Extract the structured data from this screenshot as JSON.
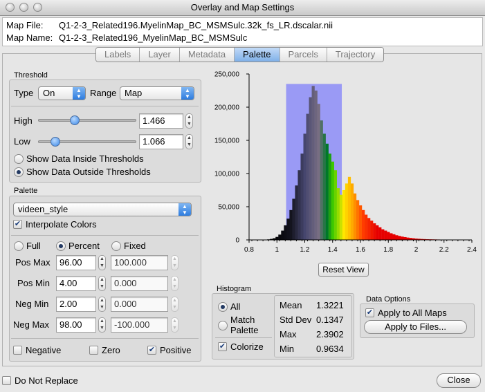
{
  "window": {
    "title": "Overlay and Map Settings"
  },
  "info": {
    "map_file_label": "Map File:",
    "map_file_value": "Q1-2-3_Related196.MyelinMap_BC_MSMSulc.32k_fs_LR.dscalar.nii",
    "map_name_label": "Map Name:",
    "map_name_value": "Q1-2-3_Related196_MyelinMap_BC_MSMSulc"
  },
  "tabs": [
    "Labels",
    "Layer",
    "Metadata",
    "Palette",
    "Parcels",
    "Trajectory"
  ],
  "active_tab": "Palette",
  "threshold": {
    "group_label": "Threshold",
    "type_label": "Type",
    "type_value": "On",
    "range_label": "Range",
    "range_value": "Map",
    "high_label": "High",
    "high_value": "1.466",
    "high_slider_fraction": 0.36,
    "low_label": "Low",
    "low_value": "1.066",
    "low_slider_fraction": 0.14,
    "inside_label": "Show Data Inside Thresholds",
    "outside_label": "Show Data Outside Thresholds",
    "selected": "outside"
  },
  "palette": {
    "group_label": "Palette",
    "name": "videen_style",
    "interpolate_label": "Interpolate Colors",
    "interpolate_checked": true,
    "mode_full": "Full",
    "mode_percent": "Percent",
    "mode_fixed": "Fixed",
    "mode_selected": "Percent",
    "pos_max_label": "Pos Max",
    "pos_max_value": "96.00",
    "pos_max_fixed": "100.000",
    "pos_min_label": "Pos Min",
    "pos_min_value": "4.00",
    "pos_min_fixed": "0.000",
    "neg_min_label": "Neg Min",
    "neg_min_value": "2.00",
    "neg_min_fixed": "0.000",
    "neg_max_label": "Neg Max",
    "neg_max_value": "98.00",
    "neg_max_fixed": "-100.000",
    "negative_label": "Negative",
    "negative_checked": false,
    "zero_label": "Zero",
    "zero_checked": false,
    "positive_label": "Positive",
    "positive_checked": true
  },
  "chart_data": {
    "type": "bar",
    "title": "",
    "xlabel": "",
    "ylabel": "",
    "xlim": [
      0.8,
      2.4
    ],
    "ylim": [
      0,
      250000
    ],
    "x_ticks": [
      "0.8",
      "1",
      "1.2",
      "1.4",
      "1.6",
      "1.8",
      "2",
      "2.2",
      "2.4"
    ],
    "y_ticks": [
      "0",
      "50,000",
      "100,000",
      "150,000",
      "200,000",
      "250,000"
    ],
    "threshold_band": {
      "x0": 1.066,
      "x1": 1.466,
      "color": "#9a9af5"
    },
    "bin_width": 0.02,
    "x": [
      0.92,
      0.94,
      0.96,
      0.98,
      1.0,
      1.02,
      1.04,
      1.06,
      1.08,
      1.1,
      1.12,
      1.14,
      1.16,
      1.18,
      1.2,
      1.22,
      1.24,
      1.26,
      1.28,
      1.3,
      1.32,
      1.34,
      1.36,
      1.38,
      1.4,
      1.42,
      1.44,
      1.46,
      1.48,
      1.5,
      1.52,
      1.54,
      1.56,
      1.58,
      1.6,
      1.62,
      1.64,
      1.66,
      1.68,
      1.7,
      1.72,
      1.74,
      1.76,
      1.78,
      1.8,
      1.82,
      1.84,
      1.86,
      1.88,
      1.9,
      1.92,
      1.94,
      1.96,
      1.98,
      2.0,
      2.02,
      2.04,
      2.06,
      2.08,
      2.1,
      2.12,
      2.14,
      2.16,
      2.18,
      2.2,
      2.22,
      2.24,
      2.26,
      2.28,
      2.3,
      2.32,
      2.34,
      2.36,
      2.38
    ],
    "values": [
      500,
      800,
      1500,
      2500,
      4500,
      8000,
      14000,
      22000,
      32000,
      45000,
      62000,
      82000,
      105000,
      130000,
      160000,
      190000,
      215000,
      232000,
      225000,
      205000,
      180000,
      160000,
      145000,
      130000,
      118000,
      105000,
      78000,
      68000,
      75000,
      85000,
      95000,
      85000,
      70000,
      60000,
      52000,
      45000,
      38000,
      33000,
      29000,
      25000,
      22000,
      19000,
      16000,
      14000,
      12000,
      10000,
      8500,
      7000,
      6000,
      5000,
      4200,
      3500,
      3000,
      2500,
      2000,
      1700,
      1400,
      1200,
      1000,
      900,
      800,
      700,
      600,
      500,
      450,
      400,
      350,
      300,
      250,
      200,
      180,
      150,
      120,
      100
    ],
    "reset_label": "Reset View"
  },
  "histogram": {
    "group_label": "Histogram",
    "all_label": "All",
    "match_label": "Match Palette",
    "selected": "All",
    "colorize_label": "Colorize",
    "colorize_checked": true,
    "stats": [
      {
        "label": "Mean",
        "value": "1.3221"
      },
      {
        "label": "Std Dev",
        "value": "0.1347"
      },
      {
        "label": "Max",
        "value": "2.3902"
      },
      {
        "label": "Min",
        "value": "0.9634"
      }
    ]
  },
  "data_options": {
    "group_label": "Data Options",
    "apply_all_label": "Apply to All Maps",
    "apply_all_checked": true,
    "apply_files_label": "Apply to Files..."
  },
  "footer": {
    "do_not_replace_label": "Do Not Replace",
    "do_not_replace_checked": false,
    "close_label": "Close"
  }
}
